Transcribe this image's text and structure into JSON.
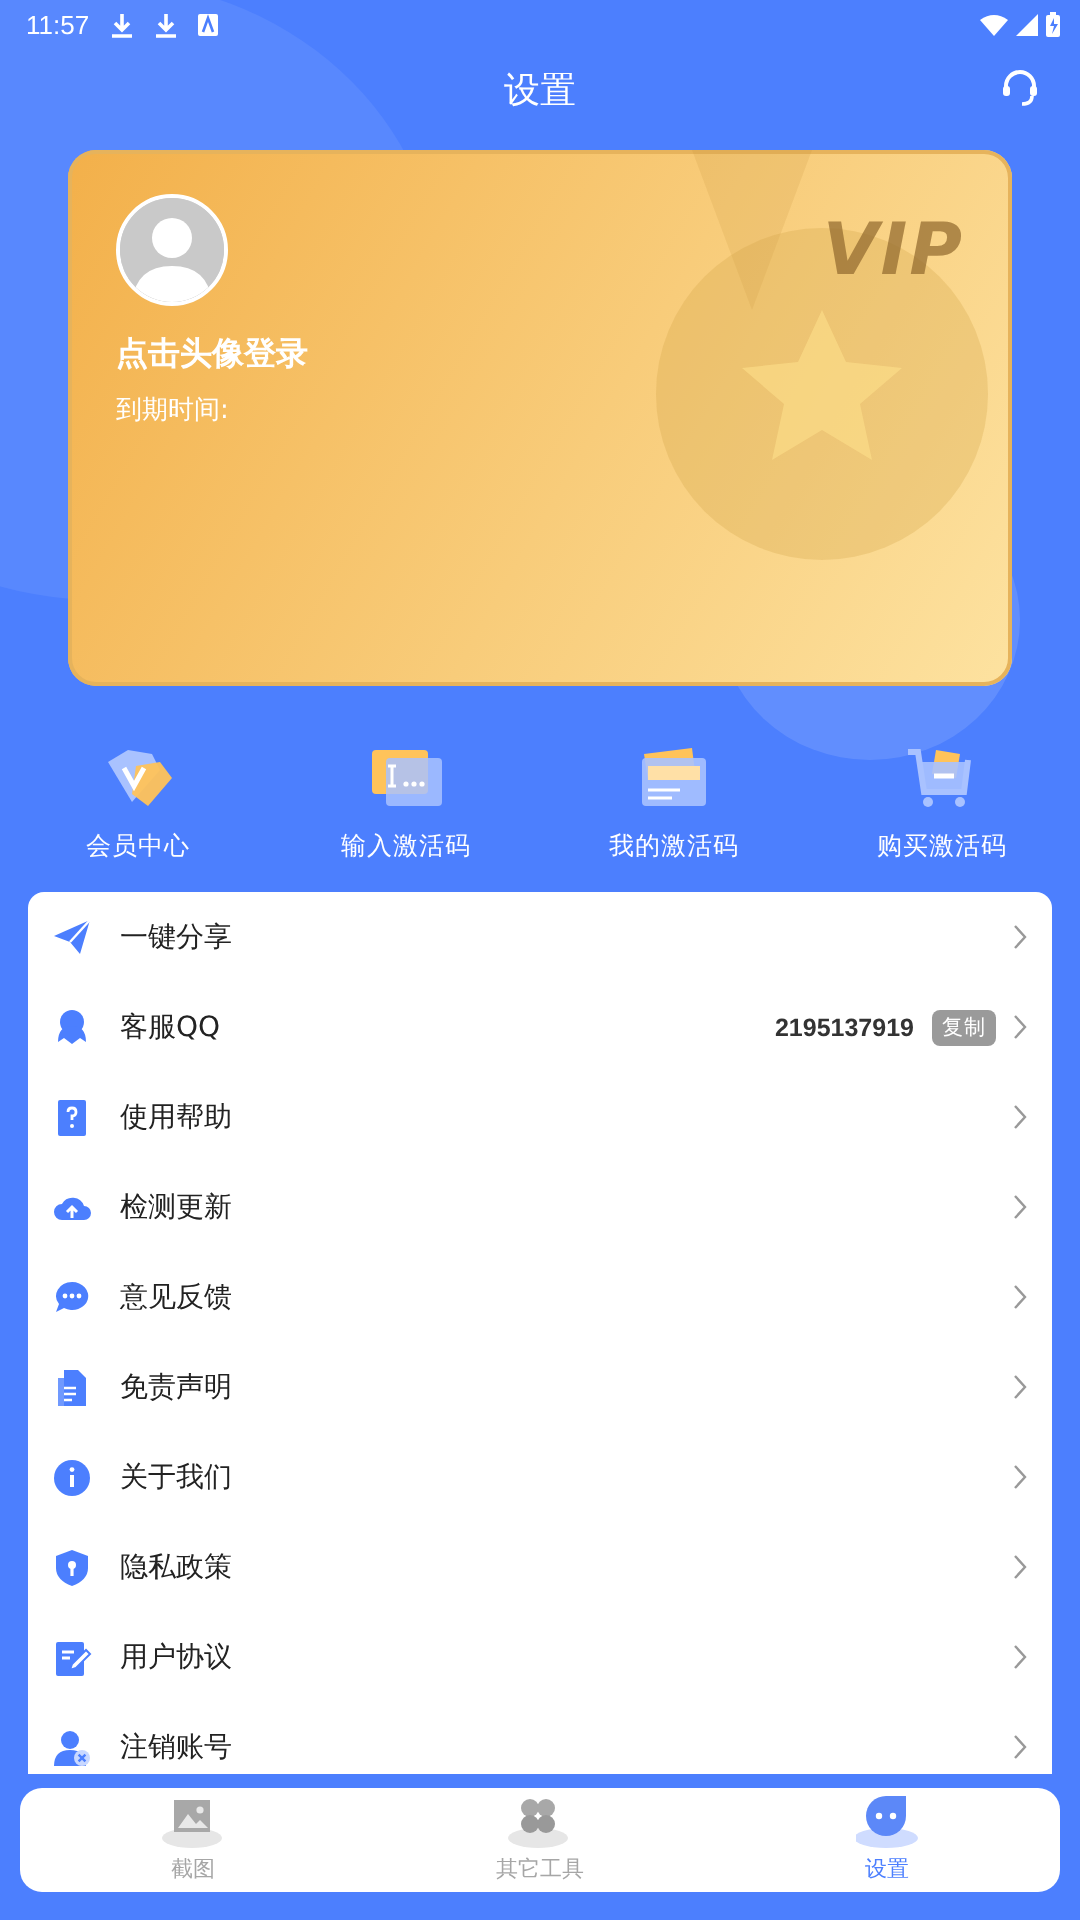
{
  "status_bar": {
    "time": "11:57"
  },
  "header": {
    "title": "设置"
  },
  "vip_card": {
    "badge": "VIP",
    "login_prompt": "点击头像登录",
    "expiry_label": "到期时间:"
  },
  "quick_actions": [
    {
      "label": "会员中心"
    },
    {
      "label": "输入激活码"
    },
    {
      "label": "我的激活码"
    },
    {
      "label": "购买激活码"
    }
  ],
  "menu": [
    {
      "label": "一键分享"
    },
    {
      "label": "客服QQ",
      "value": "2195137919",
      "action": "复制"
    },
    {
      "label": "使用帮助"
    },
    {
      "label": "检测更新"
    },
    {
      "label": "意见反馈"
    },
    {
      "label": "免责声明"
    },
    {
      "label": "关于我们"
    },
    {
      "label": "隐私政策"
    },
    {
      "label": "用户协议"
    },
    {
      "label": "注销账号"
    }
  ],
  "tab_bar": [
    {
      "label": "截图",
      "selected": false
    },
    {
      "label": "其它工具",
      "selected": false
    },
    {
      "label": "设置",
      "selected": true
    }
  ]
}
